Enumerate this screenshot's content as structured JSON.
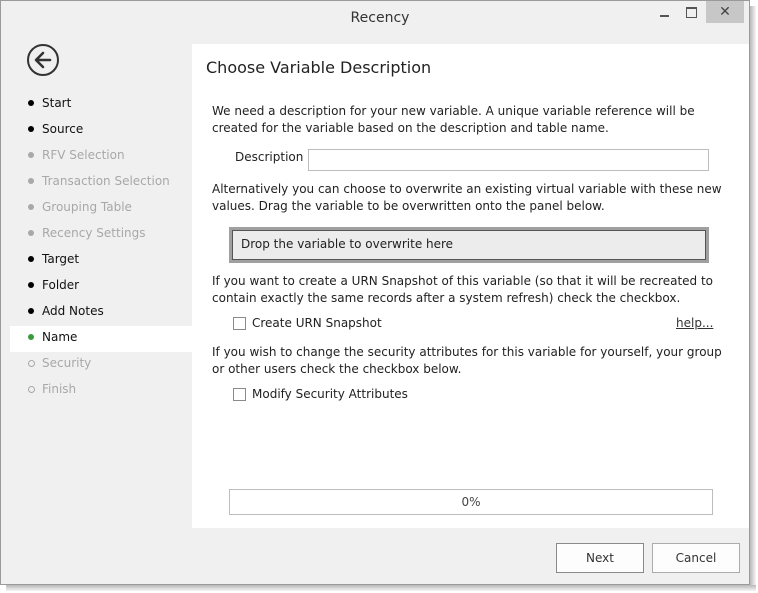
{
  "window": {
    "title": "Recency",
    "controls": {
      "minimize": "minimize",
      "maximize": "maximize",
      "close": "✕"
    }
  },
  "sidebar": {
    "items": [
      {
        "label": "Start",
        "state": "done"
      },
      {
        "label": "Source",
        "state": "done"
      },
      {
        "label": "RFV Selection",
        "state": "disabled"
      },
      {
        "label": "Transaction Selection",
        "state": "disabled"
      },
      {
        "label": "Grouping Table",
        "state": "disabled"
      },
      {
        "label": "Recency Settings",
        "state": "disabled"
      },
      {
        "label": "Target",
        "state": "done"
      },
      {
        "label": "Folder",
        "state": "done"
      },
      {
        "label": "Add Notes",
        "state": "done"
      },
      {
        "label": "Name",
        "state": "active"
      },
      {
        "label": "Security",
        "state": "pending"
      },
      {
        "label": "Finish",
        "state": "pending"
      }
    ]
  },
  "main": {
    "heading": "Choose Variable Description",
    "intro": "We need a description for your new variable.  A unique variable reference will be created for the variable based on the description and table name.",
    "description_label": "Description",
    "description_value": "",
    "overwrite_text": "Alternatively you can choose to overwrite an existing virtual variable with these new values. Drag the variable to be overwritten onto the panel below.",
    "drop_zone": "Drop the variable to overwrite here",
    "urn_text": "If you want to create a URN Snapshot of this variable (so that it will be recreated to contain exactly the same records after a system refresh) check the checkbox.",
    "urn_checkbox": "Create URN Snapshot",
    "urn_checked": false,
    "help_link": "help...",
    "security_text": "If you wish to change the security attributes for this variable for yourself, your group or other users check the checkbox below.",
    "security_checkbox": "Modify Security Attributes",
    "security_checked": false,
    "progress_text": "0%",
    "progress_value": 0
  },
  "footer": {
    "next": "Next",
    "cancel": "Cancel"
  },
  "colors": {
    "active_dot": "#3a9b3a",
    "disabled": "#a8a8a8"
  }
}
